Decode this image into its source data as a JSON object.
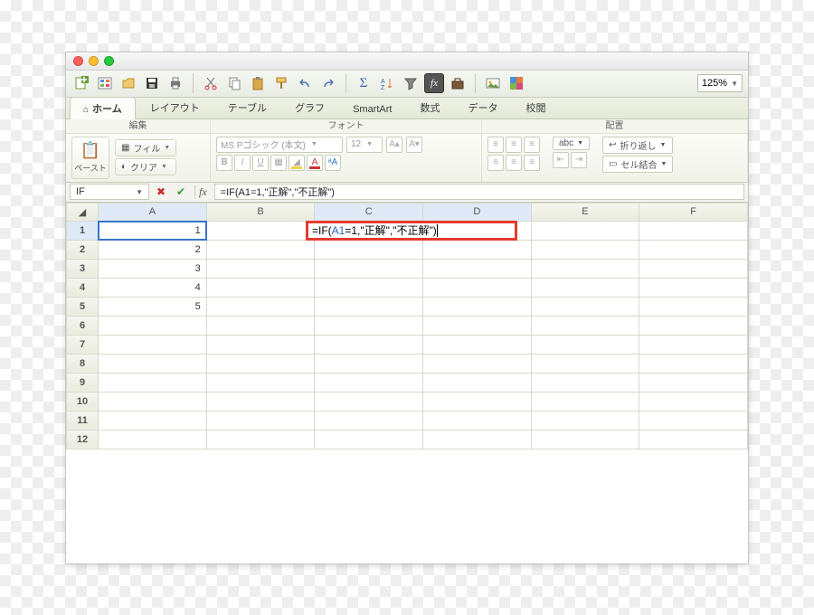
{
  "window": {
    "traffic": [
      "close",
      "minimize",
      "zoom"
    ]
  },
  "qat": {
    "icons": [
      "new-workbook",
      "template-gallery",
      "open",
      "save",
      "print",
      "cut",
      "copy",
      "paste",
      "format-painter",
      "undo",
      "redo",
      "autosum",
      "sort",
      "filter",
      "fx",
      "show-hide",
      "gallery"
    ],
    "zoom": "125%"
  },
  "ribbon": {
    "tabs": [
      "ホーム",
      "レイアウト",
      "テーブル",
      "グラフ",
      "SmartArt",
      "数式",
      "データ",
      "校閲"
    ],
    "active_tab_index": 0,
    "groups": {
      "g1": "編集",
      "g2": "フォント",
      "g3": "配置"
    },
    "paste_label": "ペースト",
    "fill_label": "フィル",
    "clear_label": "クリア",
    "font_name": "MS Pゴシック (本文)",
    "font_size": "12",
    "wrap_label": "折り返し",
    "merge_label": "セル結合",
    "abc_label": "abc"
  },
  "formula_bar": {
    "name_box": "IF",
    "fx": "fx",
    "formula": "=IF(A1=1,\"正解\",\"不正解\")"
  },
  "grid": {
    "columns": [
      "A",
      "B",
      "C",
      "D",
      "E",
      "F"
    ],
    "rows": [
      1,
      2,
      3,
      4,
      5,
      6,
      7,
      8,
      9,
      10,
      11,
      12
    ],
    "a_values": {
      "1": "1",
      "2": "2",
      "3": "3",
      "4": "4",
      "5": "5"
    },
    "editing_cell": "C1",
    "editing_display_prefix": "=IF(",
    "editing_display_ref": "A1",
    "editing_display_suffix": "=1,\"正解\",\"不正解\")",
    "active_ref_cell": "A1"
  }
}
